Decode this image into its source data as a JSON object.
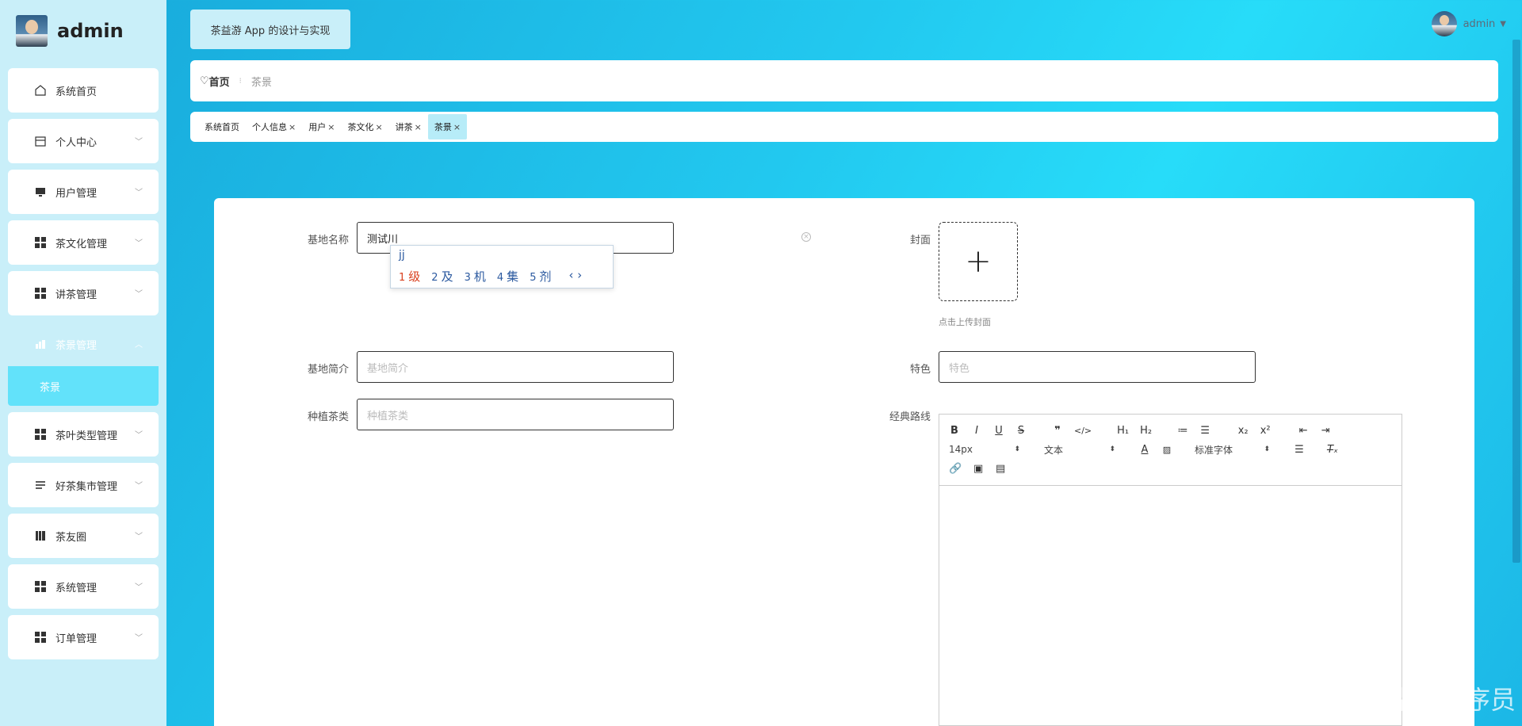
{
  "app": {
    "user_name": "admin",
    "title": "茶益游 App 的设计与实现"
  },
  "sidebar": {
    "items": [
      {
        "label": "系统首页",
        "icon": "home-icon"
      },
      {
        "label": "个人中心",
        "icon": "calendar-icon"
      },
      {
        "label": "用户管理",
        "icon": "monitor-icon"
      },
      {
        "label": "茶文化管理",
        "icon": "grid-icon"
      },
      {
        "label": "讲茶管理",
        "icon": "grid-icon"
      },
      {
        "label": "茶景管理",
        "icon": "chart-icon"
      },
      {
        "label": "茶叶类型管理",
        "icon": "grid-icon"
      },
      {
        "label": "好茶集市管理",
        "icon": "list-icon"
      },
      {
        "label": "茶友圈",
        "icon": "book-icon"
      },
      {
        "label": "系统管理",
        "icon": "grid-icon"
      },
      {
        "label": "订单管理",
        "icon": "grid-icon"
      }
    ],
    "active_sub": "茶景"
  },
  "breadcrumb": {
    "home": "首页",
    "current": "茶景"
  },
  "tabs": [
    "系统首页",
    "个人信息",
    "用户",
    "茶文化",
    "讲茶",
    "茶景"
  ],
  "form": {
    "name_label": "基地名称",
    "name_value": "测试川",
    "intro_label": "基地简介",
    "intro_placeholder": "基地简介",
    "plant_label": "种植茶类",
    "plant_placeholder": "种植茶类",
    "cover_label": "封面",
    "cover_hint": "点击上传封面",
    "feature_label": "特色",
    "feature_placeholder": "特色",
    "route_label": "经典路线"
  },
  "ime": {
    "composition": "jj",
    "candidates": [
      {
        "n": "1",
        "w": "级"
      },
      {
        "n": "2",
        "w": "及"
      },
      {
        "n": "3",
        "w": "机"
      },
      {
        "n": "4",
        "w": "集"
      },
      {
        "n": "5",
        "w": "剂"
      }
    ],
    "more": "‹ ›"
  },
  "editor": {
    "font_size": "14px",
    "block_type": "文本",
    "font_family": "标准字体"
  },
  "watermark": "CSDN @毕业程序员",
  "colors": {
    "accent": "#22c8ef",
    "sidebar_bg": "#c9eff9",
    "active_sub_bg": "#62e2fa"
  }
}
